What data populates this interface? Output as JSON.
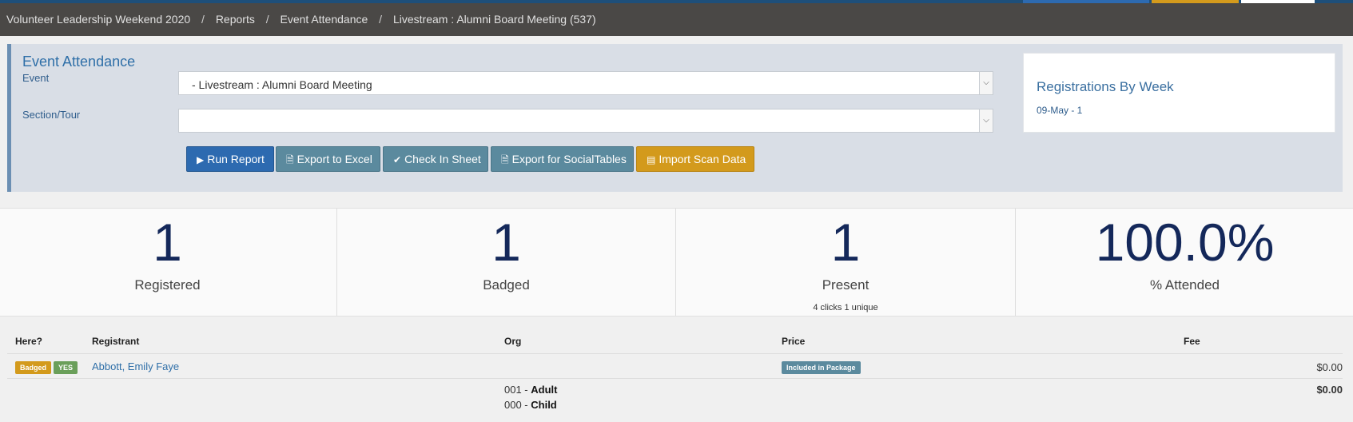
{
  "breadcrumbs": {
    "root": "Volunteer Leadership Weekend 2020",
    "reports": "Reports",
    "attendance": "Event Attendance",
    "current": "Livestream : Alumni Board Meeting (537)"
  },
  "panel": {
    "title": "Event Attendance",
    "event_label": "Event",
    "event_value": "- Livestream : Alumni Board Meeting",
    "section_label": "Section/Tour",
    "section_value": ""
  },
  "buttons": {
    "run_report": "Run Report",
    "export_excel": "Export to Excel",
    "check_in_sheet": "Check In Sheet",
    "export_socialtables": "Export for SocialTables",
    "import_scan": "Import Scan Data"
  },
  "registrations_by_week": {
    "title": "Registrations By Week",
    "item": "09-May - 1"
  },
  "stats": [
    {
      "value": "1",
      "label": "Registered"
    },
    {
      "value": "1",
      "label": "Badged"
    },
    {
      "value": "1",
      "label": "Present",
      "sub": "4 clicks 1 unique"
    },
    {
      "value": "100.0%",
      "label": "% Attended"
    }
  ],
  "table": {
    "headers": {
      "here": "Here?",
      "registrant": "Registrant",
      "org": "Org",
      "price": "Price",
      "fee": "Fee"
    },
    "rows": [
      {
        "badge1": "Badged",
        "badge2": "YES",
        "registrant": "Abbott, Emily Faye",
        "price_badge": "Included in Package",
        "fee": "$0.00"
      }
    ],
    "summary": {
      "line1_code": "001 - ",
      "line1_name": "Adult",
      "line2_code": "000 - ",
      "line2_name": "Child",
      "fee_total": "$0.00"
    }
  },
  "colors": {
    "topbar": "#4a4846",
    "accent_blue": "#2d6ab0",
    "button_gray": "#5b8a9e",
    "button_gold": "#d39a1c",
    "stat_number": "#14285a"
  }
}
